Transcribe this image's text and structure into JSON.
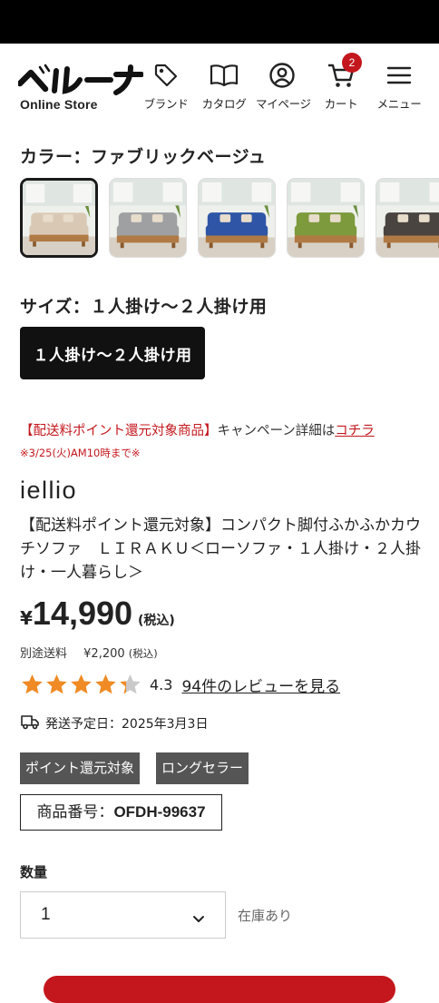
{
  "header": {
    "logo_text": "ベルーナ",
    "logo_sub": "Online Store",
    "nav": [
      {
        "label": "ブランド",
        "icon": "tag-icon"
      },
      {
        "label": "カタログ",
        "icon": "book-icon"
      },
      {
        "label": "マイページ",
        "icon": "user-icon"
      },
      {
        "label": "カート",
        "icon": "cart-icon",
        "badge": "2"
      },
      {
        "label": "メニュー",
        "icon": "menu-icon"
      }
    ]
  },
  "color": {
    "label": "カラー：ファブリックベージュ",
    "swatches": [
      {
        "color": "#d9c9b4",
        "selected": true
      },
      {
        "color": "#9ea0a2",
        "selected": false
      },
      {
        "color": "#2f56a6",
        "selected": false
      },
      {
        "color": "#7d9a3c",
        "selected": false
      },
      {
        "color": "#4a4440",
        "selected": false
      }
    ]
  },
  "size": {
    "label": "サイズ：１人掛け～２人掛け用",
    "options": [
      "１人掛け～２人掛け用"
    ]
  },
  "campaign": {
    "highlight": "【配送料ポイント還元対象商品】",
    "text": "キャンペーン詳細は",
    "link": "コチラ",
    "deadline": "※3/25(火)AM10時まで※"
  },
  "product": {
    "brand": "iellio",
    "title": "【配送料ポイント還元対象】コンパクト脚付ふかふかカウチソファ　ＬＩＲＡＫＵ＜ローソファ・１人掛け・２人掛け・一人暮らし＞",
    "currency": "¥",
    "price": "14,990",
    "tax": "(税込)",
    "shipping_label": "別途送料",
    "shipping_price": "¥2,200",
    "shipping_tax": "(税込)",
    "rating": 4.3,
    "rating_text": "4.3",
    "reviews_link": "94件のレビューを見る",
    "delivery": "発送予定日：2025年3月3日",
    "tags": [
      "ポイント還元対象",
      "ロングセラー"
    ],
    "sku_label": "商品番号：",
    "sku": "OFDH-99637"
  },
  "quantity": {
    "label": "数量",
    "value": "1",
    "stock": "在庫あり"
  },
  "colors": {
    "accent": "#c3171d",
    "star": "#f08a24",
    "tag_bg": "#555555"
  }
}
